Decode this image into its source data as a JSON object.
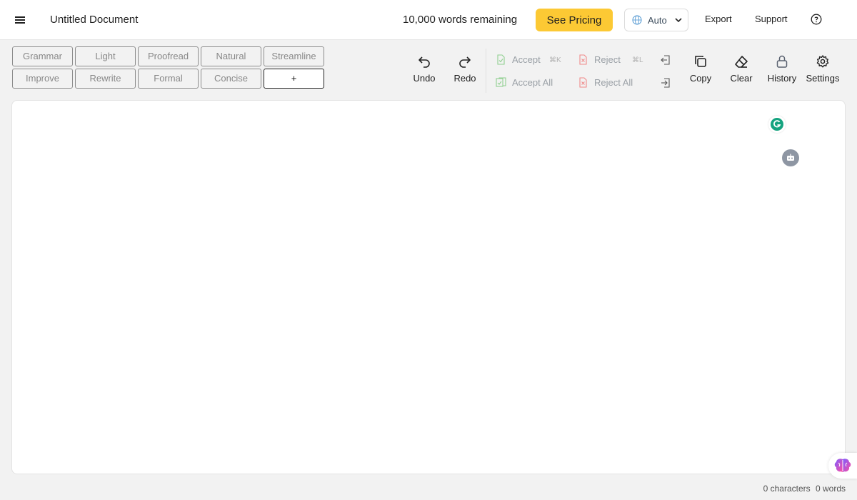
{
  "header": {
    "menu_icon": "hamburger-icon",
    "title": "Untitled Document",
    "words_remaining": "10,000 words remaining",
    "pricing_label": "See Pricing",
    "language": "Auto",
    "export_label": "Export",
    "support_label": "Support",
    "help_icon": "question-circle-icon",
    "accent_color": "#fcc934"
  },
  "chips": {
    "row1": [
      "Grammar",
      "Light",
      "Proofread",
      "Natural",
      "Streamline"
    ],
    "row2": [
      "Improve",
      "Rewrite",
      "Formal",
      "Concise",
      "+"
    ]
  },
  "toolbar": {
    "undo": "Undo",
    "redo": "Redo",
    "accept": "Accept",
    "accept_shortcut": "⌘K",
    "accept_all": "Accept All",
    "reject": "Reject",
    "reject_shortcut": "⌘L",
    "reject_all": "Reject All",
    "copy": "Copy",
    "clear": "Clear",
    "history": "History",
    "settings": "Settings"
  },
  "footer": {
    "characters": "0 characters",
    "words": "0 words"
  }
}
